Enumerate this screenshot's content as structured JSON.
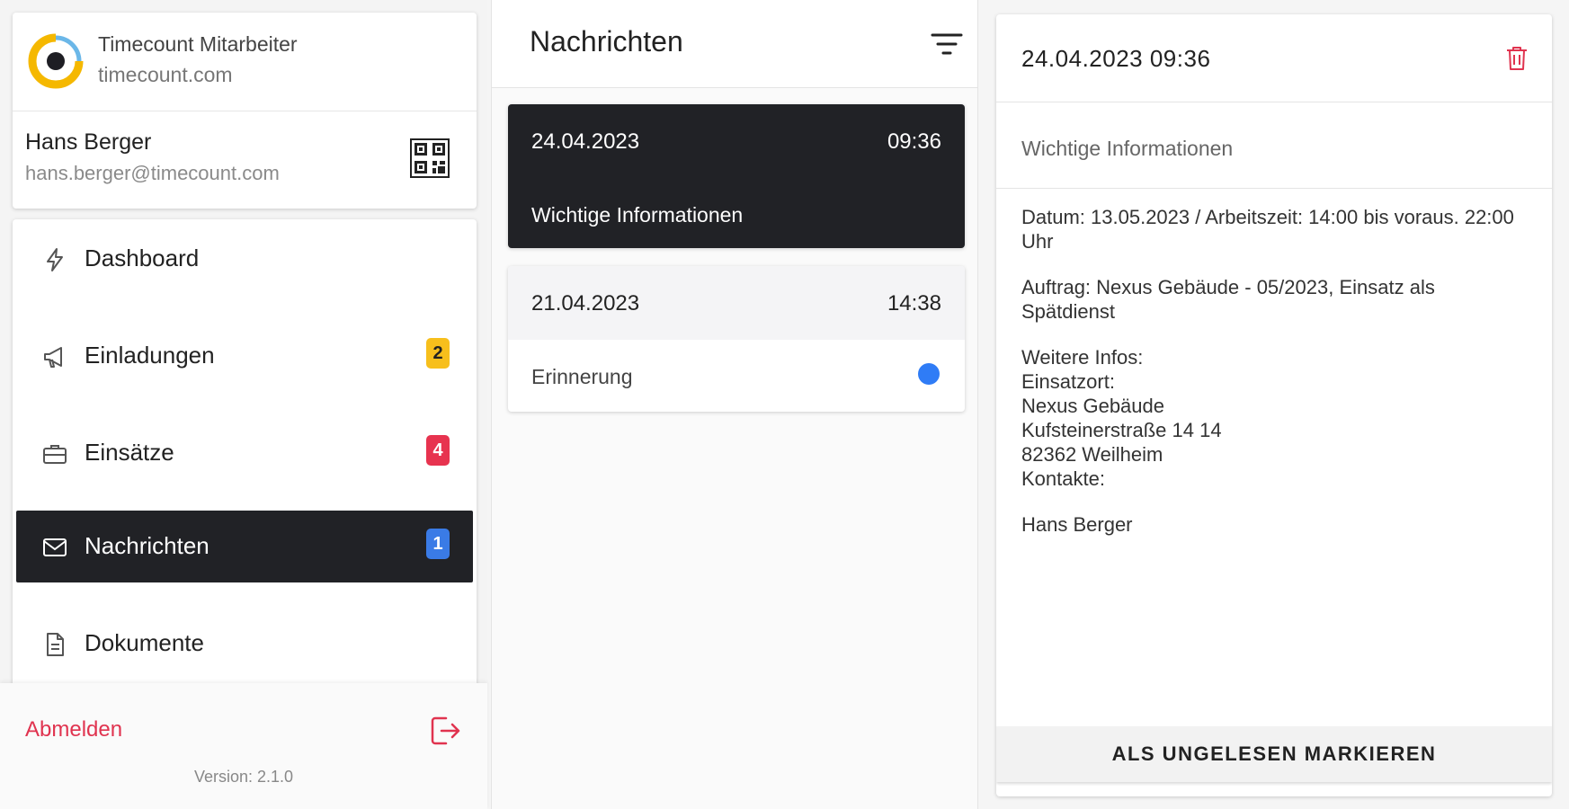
{
  "sidebar": {
    "app_name": "Timecount Mitarbeiter",
    "app_domain": "timecount.com",
    "user_name": "Hans Berger",
    "user_email": "hans.berger@timecount.com",
    "items": [
      {
        "label": "Dashboard",
        "icon": "lightning-icon",
        "badge": ""
      },
      {
        "label": "Einladungen",
        "icon": "megaphone-icon",
        "badge": "2",
        "badge_color": "#f7bf1c"
      },
      {
        "label": "Einsätze",
        "icon": "briefcase-icon",
        "badge": "4",
        "badge_color": "#e7334f"
      },
      {
        "label": "Nachrichten",
        "icon": "envelope-icon",
        "badge": "1",
        "badge_color": "#3a7be6",
        "active": true
      },
      {
        "label": "Dokumente",
        "icon": "document-icon",
        "badge": ""
      }
    ],
    "logout_label": "Abmelden",
    "version": "Version: 2.1.0"
  },
  "messages": {
    "title": "Nachrichten",
    "list": [
      {
        "date": "24.04.2023",
        "time": "09:36",
        "subject": "Wichtige Informationen",
        "active": true
      },
      {
        "date": "21.04.2023",
        "time": "14:38",
        "subject": "Erinnerung",
        "unread": true
      }
    ]
  },
  "detail": {
    "datetime": "24.04.2023 09:36",
    "subject": "Wichtige Informationen",
    "body": [
      [
        "Datum: 13.05.2023 / Arbeitszeit: 14:00 bis voraus. 22:00 Uhr"
      ],
      [
        "Auftrag: Nexus Gebäude - 05/2023, Einsatz als Spätdienst"
      ],
      [
        "Weitere Infos:",
        "Einsatzort:",
        "Nexus Gebäude",
        "Kufsteinerstraße 14 14",
        "82362 Weilheim",
        "Kontakte:"
      ],
      [
        "Hans Berger"
      ]
    ],
    "mark_unread_label": "ALS UNGELESEN MARKIEREN"
  },
  "colors": {
    "dark": "#212226",
    "accent_red": "#e0334f",
    "accent_blue": "#2f7cf6"
  }
}
